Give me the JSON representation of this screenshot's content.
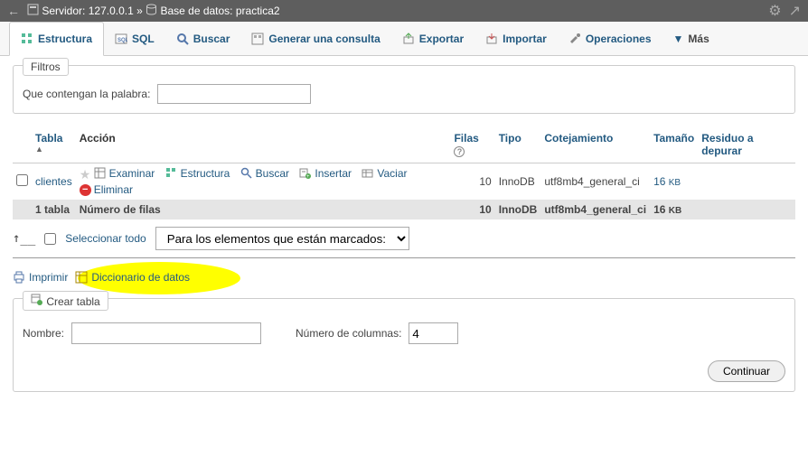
{
  "breadcrumb": {
    "server_label": "Servidor:",
    "server_value": "127.0.0.1",
    "db_label": "Base de datos:",
    "db_value": "practica2"
  },
  "tabs": {
    "structure": "Estructura",
    "sql": "SQL",
    "search": "Buscar",
    "query": "Generar una consulta",
    "export": "Exportar",
    "import": "Importar",
    "operations": "Operaciones",
    "more": "Más"
  },
  "filters": {
    "legend": "Filtros",
    "label": "Que contengan la palabra:",
    "value": ""
  },
  "headers": {
    "table": "Tabla",
    "action": "Acción",
    "rows": "Filas",
    "type": "Tipo",
    "collation": "Cotejamiento",
    "size": "Tamaño",
    "overhead": "Residuo a depurar"
  },
  "actions": {
    "browse": "Examinar",
    "structure": "Estructura",
    "search": "Buscar",
    "insert": "Insertar",
    "empty": "Vaciar",
    "drop": "Eliminar"
  },
  "rows": [
    {
      "name": "clientes",
      "rows": "10",
      "type": "InnoDB",
      "collation": "utf8mb4_general_ci",
      "size": "16",
      "size_unit": "KB"
    }
  ],
  "footer": {
    "label": "1 tabla",
    "sum_label": "Número de filas",
    "rows": "10",
    "type": "InnoDB",
    "collation": "utf8mb4_general_ci",
    "size": "16",
    "size_unit": "KB"
  },
  "selectall": {
    "label": "Seleccionar todo",
    "dropdown": "Para los elementos que están marcados:"
  },
  "links": {
    "print": "Imprimir",
    "dictionary": "Diccionario de datos"
  },
  "create": {
    "legend": "Crear tabla",
    "name_label": "Nombre:",
    "name_value": "",
    "cols_label": "Número de columnas:",
    "cols_value": "4",
    "button": "Continuar"
  }
}
